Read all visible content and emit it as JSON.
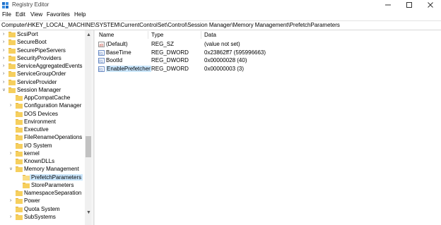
{
  "window": {
    "title": "Registry Editor",
    "icon": "registry-editor-icon",
    "controls": [
      "minimize-icon",
      "maximize-icon",
      "close-icon"
    ]
  },
  "menu": [
    "File",
    "Edit",
    "View",
    "Favorites",
    "Help"
  ],
  "address": "Computer\\HKEY_LOCAL_MACHINE\\SYSTEM\\CurrentControlSet\\Control\\Session Manager\\Memory Management\\PrefetchParameters",
  "tree": [
    {
      "label": "ScsiPort",
      "expandable": true,
      "expanded": false,
      "level": 1
    },
    {
      "label": "SecureBoot",
      "expandable": true,
      "expanded": false,
      "level": 1
    },
    {
      "label": "SecurePipeServers",
      "expandable": true,
      "expanded": false,
      "level": 1
    },
    {
      "label": "SecurityProviders",
      "expandable": true,
      "expanded": false,
      "level": 1
    },
    {
      "label": "ServiceAggregatedEvents",
      "expandable": true,
      "expanded": false,
      "level": 1
    },
    {
      "label": "ServiceGroupOrder",
      "expandable": true,
      "expanded": false,
      "level": 1
    },
    {
      "label": "ServiceProvider",
      "expandable": true,
      "expanded": false,
      "level": 1
    },
    {
      "label": "Session Manager",
      "expandable": true,
      "expanded": true,
      "level": 1
    },
    {
      "label": "AppCompatCache",
      "expandable": false,
      "expanded": false,
      "level": 2
    },
    {
      "label": "Configuration Manager",
      "expandable": true,
      "expanded": false,
      "level": 2
    },
    {
      "label": "DOS Devices",
      "expandable": false,
      "expanded": false,
      "level": 2
    },
    {
      "label": "Environment",
      "expandable": false,
      "expanded": false,
      "level": 2
    },
    {
      "label": "Executive",
      "expandable": false,
      "expanded": false,
      "level": 2
    },
    {
      "label": "FileRenameOperations",
      "expandable": false,
      "expanded": false,
      "level": 2
    },
    {
      "label": "I/O System",
      "expandable": false,
      "expanded": false,
      "level": 2
    },
    {
      "label": "kernel",
      "expandable": true,
      "expanded": false,
      "level": 2
    },
    {
      "label": "KnownDLLs",
      "expandable": false,
      "expanded": false,
      "level": 2
    },
    {
      "label": "Memory Management",
      "expandable": true,
      "expanded": true,
      "level": 2
    },
    {
      "label": "PrefetchParameters",
      "expandable": false,
      "expanded": false,
      "level": 3,
      "selected": true
    },
    {
      "label": "StoreParameters",
      "expandable": false,
      "expanded": false,
      "level": 3
    },
    {
      "label": "NamespaceSeparation",
      "expandable": false,
      "expanded": false,
      "level": 2
    },
    {
      "label": "Power",
      "expandable": true,
      "expanded": false,
      "level": 2
    },
    {
      "label": "Quota System",
      "expandable": false,
      "expanded": false,
      "level": 2
    },
    {
      "label": "SubSystems",
      "expandable": true,
      "expanded": false,
      "level": 2
    }
  ],
  "list": {
    "columns": [
      "Name",
      "Type",
      "Data"
    ],
    "rows": [
      {
        "name": "(Default)",
        "type": "REG_SZ",
        "data": "(value not set)",
        "icon": "string-value-icon",
        "selected": false
      },
      {
        "name": "BaseTime",
        "type": "REG_DWORD",
        "data": "0x23862ff7 (595996663)",
        "icon": "binary-value-icon",
        "selected": false
      },
      {
        "name": "BootId",
        "type": "REG_DWORD",
        "data": "0x00000028 (40)",
        "icon": "binary-value-icon",
        "selected": false
      },
      {
        "name": "EnablePrefetcher",
        "type": "REG_DWORD",
        "data": "0x00000003 (3)",
        "icon": "binary-value-icon",
        "selected": true
      }
    ]
  },
  "colors": {
    "folder": "#f6cf5e",
    "selection": "#cce8ff",
    "scrollbar_track": "#f0f0f0",
    "scrollbar_thumb": "#c2c2c2"
  }
}
